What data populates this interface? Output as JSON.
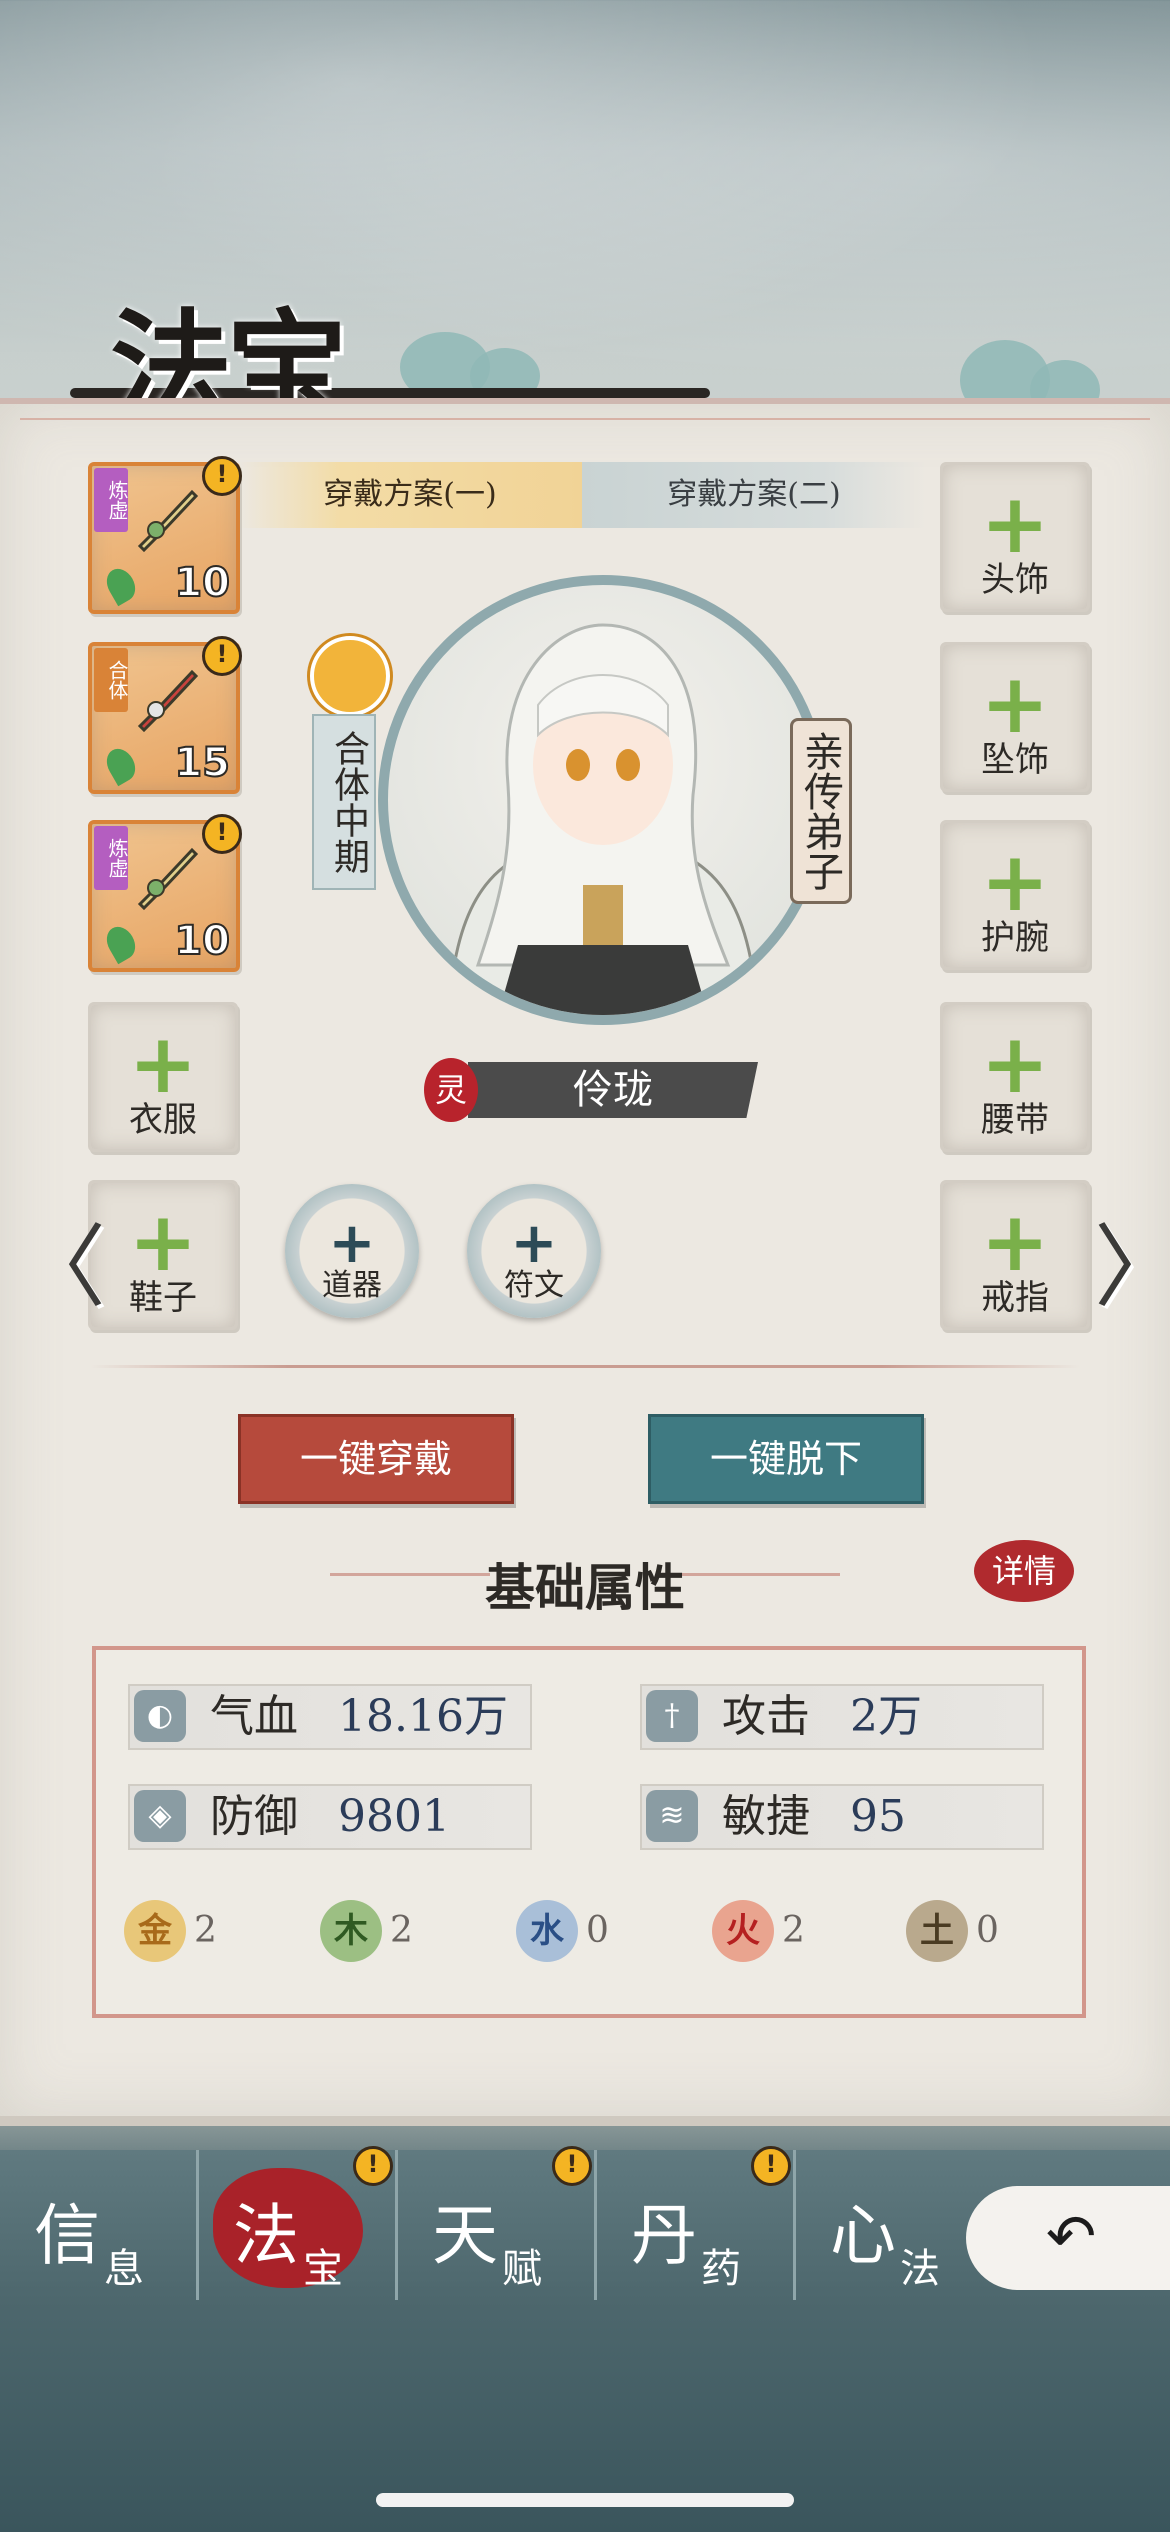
{
  "title": "法宝",
  "tabs": [
    "穿戴方案(一)",
    "穿戴方案(二)"
  ],
  "left_slots": [
    {
      "type": "equipped",
      "tag": "炼虚",
      "level": "10",
      "alert": "!"
    },
    {
      "type": "equipped",
      "tag": "合体",
      "level": "15",
      "alert": "!"
    },
    {
      "type": "equipped",
      "tag": "炼虚",
      "level": "10",
      "alert": "!"
    },
    {
      "type": "empty",
      "label": "衣服"
    },
    {
      "type": "empty",
      "label": "鞋子"
    }
  ],
  "right_slots": [
    "头饰",
    "坠饰",
    "护腕",
    "腰带",
    "戒指"
  ],
  "character": {
    "realm": "合体中期",
    "title": "亲传弟子",
    "spirit": "灵",
    "name": "伶珑"
  },
  "round_slots": [
    "道器",
    "符文"
  ],
  "buttons": {
    "equip_all": "一键穿戴",
    "unequip_all": "一键脱下"
  },
  "section_title": "基础属性",
  "detail_label": "详情",
  "stats": [
    {
      "name": "气血",
      "value": "18.16万"
    },
    {
      "name": "攻击",
      "value": "2万"
    },
    {
      "name": "防御",
      "value": "9801"
    },
    {
      "name": "敏捷",
      "value": "95"
    }
  ],
  "elements": [
    {
      "name": "金",
      "count": "2",
      "color": "#e8c779"
    },
    {
      "name": "木",
      "count": "2",
      "color": "#9cbf83"
    },
    {
      "name": "水",
      "count": "0",
      "color": "#a9bfd8"
    },
    {
      "name": "火",
      "count": "2",
      "color": "#e9a48f"
    },
    {
      "name": "土",
      "count": "0",
      "color": "#b9a98d"
    }
  ],
  "nav": [
    {
      "big": "信",
      "small": "息",
      "alert": false,
      "active": false
    },
    {
      "big": "法",
      "small": "宝",
      "alert": true,
      "active": true
    },
    {
      "big": "天",
      "small": "赋",
      "alert": true,
      "active": false
    },
    {
      "big": "丹",
      "small": "药",
      "alert": true,
      "active": false
    },
    {
      "big": "心",
      "small": "法",
      "alert": false,
      "active": false
    }
  ],
  "alert_mark": "!",
  "plus_glyph": "+",
  "arrow_left": "〈",
  "arrow_right": "〉",
  "back_glyph": "↶"
}
